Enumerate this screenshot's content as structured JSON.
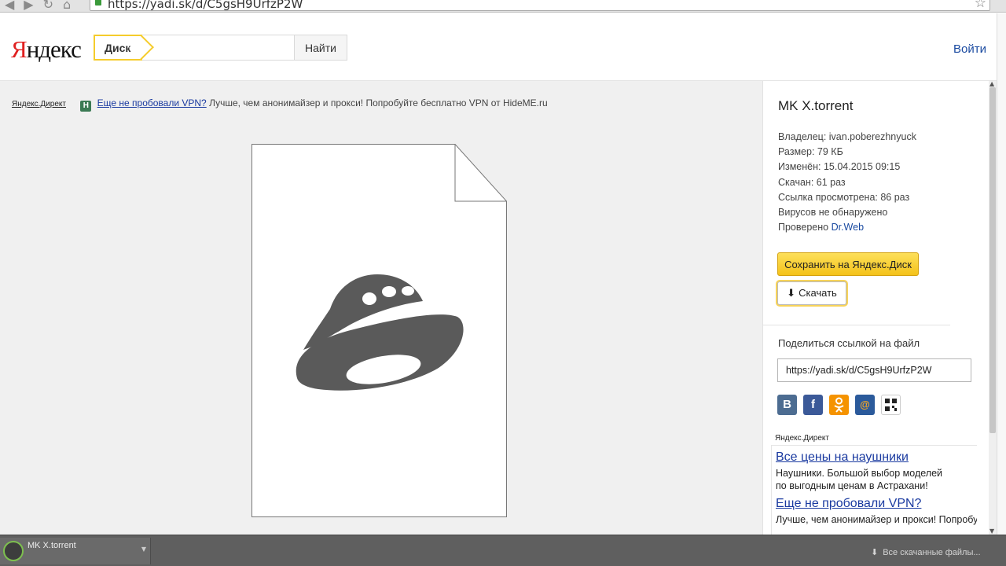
{
  "browser": {
    "url": "https://yadi.sk/d/C5gsH9UrfzP2W"
  },
  "header": {
    "logo_first": "Я",
    "logo_rest": "ндекс",
    "search_tab": "Диск",
    "search_placeholder": "",
    "search_button": "Найти",
    "login": "Войти"
  },
  "top_ad": {
    "direct_label": "Яндекс.Директ",
    "badge": "H",
    "link": "Еще не пробовали VPN?",
    "text": " Лучше, чем анонимайзер и прокси! Попробуйте бесплатно VPN от HideME.ru"
  },
  "file": {
    "title": "MK X.torrent",
    "owner": "Владелец: ivan.poberezhnyuck",
    "size": "Размер: 79 КБ",
    "modified": "Изменён: 15.04.2015 09:15",
    "downloads": "Скачан: 61 раз",
    "views": "Ссылка просмотрена: 86 раз",
    "virus": "Вирусов не обнаружено",
    "checked_prefix": "Проверено ",
    "checked_by": "Dr.Web"
  },
  "actions": {
    "save": "Сохранить на Яндекс.Диск",
    "download": "Скачать"
  },
  "share": {
    "label": "Поделиться ссылкой на файл",
    "link": "https://yadi.sk/d/C5gsH9UrfzP2W",
    "socials": [
      "В",
      "f",
      "ok",
      "@",
      "qr"
    ]
  },
  "sidebar_ads": {
    "label": "Яндекс.Директ",
    "items": [
      {
        "title": "Все цены на наушники",
        "line1": "Наушники. Большой выбор моделей",
        "line2": "по выгодным ценам в Астрахани!"
      },
      {
        "title": "Еще не пробовали VPN?",
        "line1": "Лучше, чем анонимайзер и прокси! Попробуйте",
        "line2": ""
      }
    ]
  },
  "download_shelf": {
    "item_name": "MK X.torrent",
    "item_sub": "",
    "show_all": "Все скачанные файлы..."
  },
  "colors": {
    "accent_yellow": "#f4c21a",
    "link_blue": "#1a4aa0",
    "ufo_gray": "#5a5a5a"
  },
  "icons": {
    "file_preview": "ufo-icon",
    "download": "download-arrow-icon"
  }
}
